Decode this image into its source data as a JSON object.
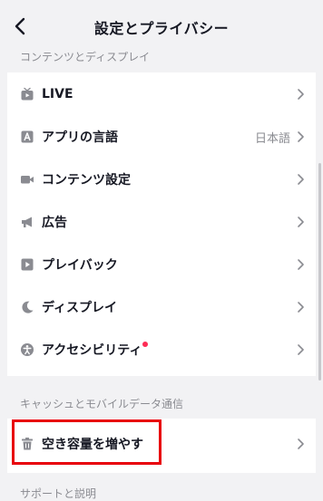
{
  "header": {
    "title": "設定とプライバシー"
  },
  "sections": {
    "content_display": "コンテンツとディスプレイ",
    "cache_data": "キャッシュとモバイルデータ通信",
    "support": "サポートと説明"
  },
  "rows": [
    {
      "label": "LIVE",
      "icon": "tv-icon"
    },
    {
      "label": "アプリの言語",
      "value": "日本語",
      "icon": "language-icon"
    },
    {
      "label": "コンテンツ設定",
      "icon": "video-camera-icon"
    },
    {
      "label": "広告",
      "icon": "megaphone-icon"
    },
    {
      "label": "プレイバック",
      "icon": "play-icon"
    },
    {
      "label": "ディスプレイ",
      "icon": "moon-icon"
    },
    {
      "label": "アクセシビリティ",
      "icon": "accessibility-icon",
      "badge": "red-dot"
    }
  ],
  "cache_rows": [
    {
      "label": "空き容量を増やす",
      "icon": "trash-icon"
    }
  ],
  "colors": {
    "accent_red": "#fe2c55",
    "highlight_border": "#e8000b",
    "background": "#f2f2f4",
    "card": "#ffffff",
    "secondary_text": "#8a8b91"
  }
}
